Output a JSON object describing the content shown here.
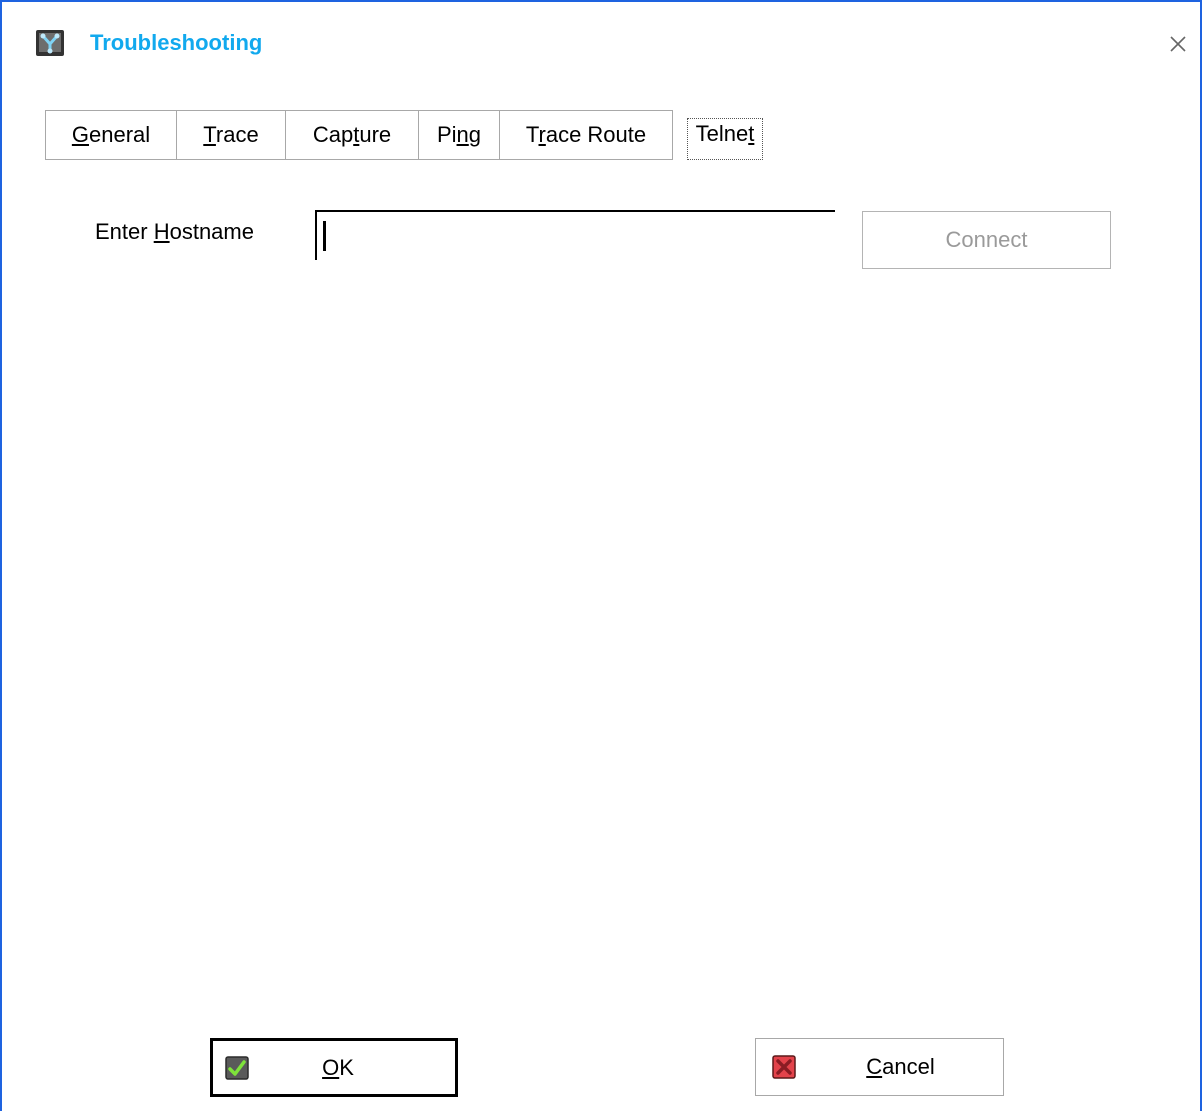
{
  "window": {
    "title": "Troubleshooting",
    "icon": "network-troubleshoot-icon",
    "close_icon": "close-icon",
    "border_color": "#1e63e0",
    "title_color": "#11a9ee"
  },
  "tabs": [
    {
      "pre": "",
      "mn": "G",
      "post": "eneral",
      "active": false
    },
    {
      "pre": "",
      "mn": "T",
      "post": "race",
      "active": false
    },
    {
      "pre": "Cap",
      "mn": "t",
      "post": "ure",
      "active": false
    },
    {
      "pre": "Pi",
      "mn": "n",
      "post": "g",
      "active": false
    },
    {
      "pre": "T",
      "mn": "r",
      "post": "ace Route",
      "active": false
    },
    {
      "pre": "Telne",
      "mn": "t",
      "post": "",
      "active": true
    }
  ],
  "hostname": {
    "label_pre": "Enter ",
    "label_mn": "H",
    "label_post": "ostname",
    "value": "",
    "placeholder": ""
  },
  "connect_button": {
    "label": "Connect",
    "enabled": false
  },
  "footer": {
    "ok": {
      "mn": "O",
      "post": "K",
      "icon": "green-check-icon"
    },
    "cancel": {
      "mn": "C",
      "post": "ancel",
      "icon": "red-x-icon"
    }
  }
}
